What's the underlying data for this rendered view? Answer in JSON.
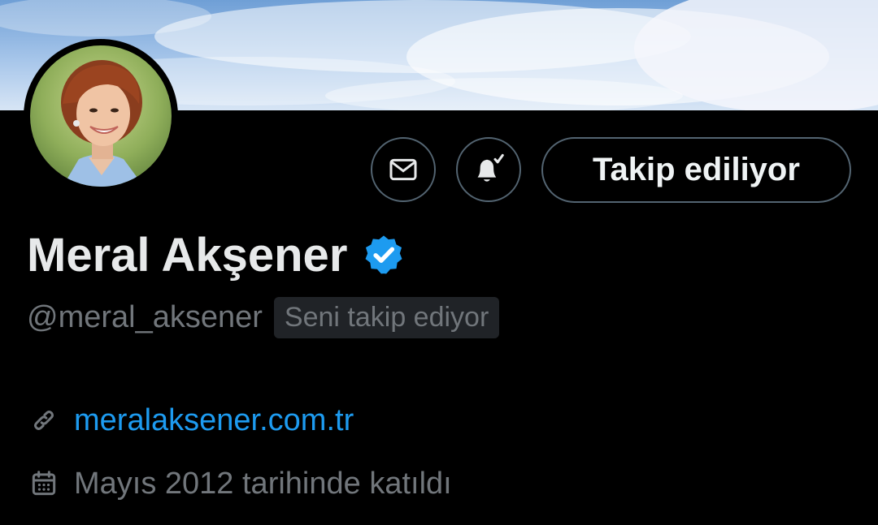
{
  "profile": {
    "display_name": "Meral Akşener",
    "handle": "@meral_aksener",
    "follows_you_badge": "Seni takip ediyor",
    "website": "meralaksener.com.tr",
    "joined": "Mayıs 2012 tarihinde katıldı",
    "verified": true
  },
  "actions": {
    "message_icon": "envelope-icon",
    "notify_icon": "bell-check-icon",
    "follow_label": "Takip ediliyor"
  },
  "colors": {
    "background": "#000000",
    "text_primary": "#e7e9ea",
    "text_secondary": "#71767b",
    "link": "#1d9bf0",
    "verified_badge": "#1d9bf0",
    "button_border": "#536471"
  }
}
